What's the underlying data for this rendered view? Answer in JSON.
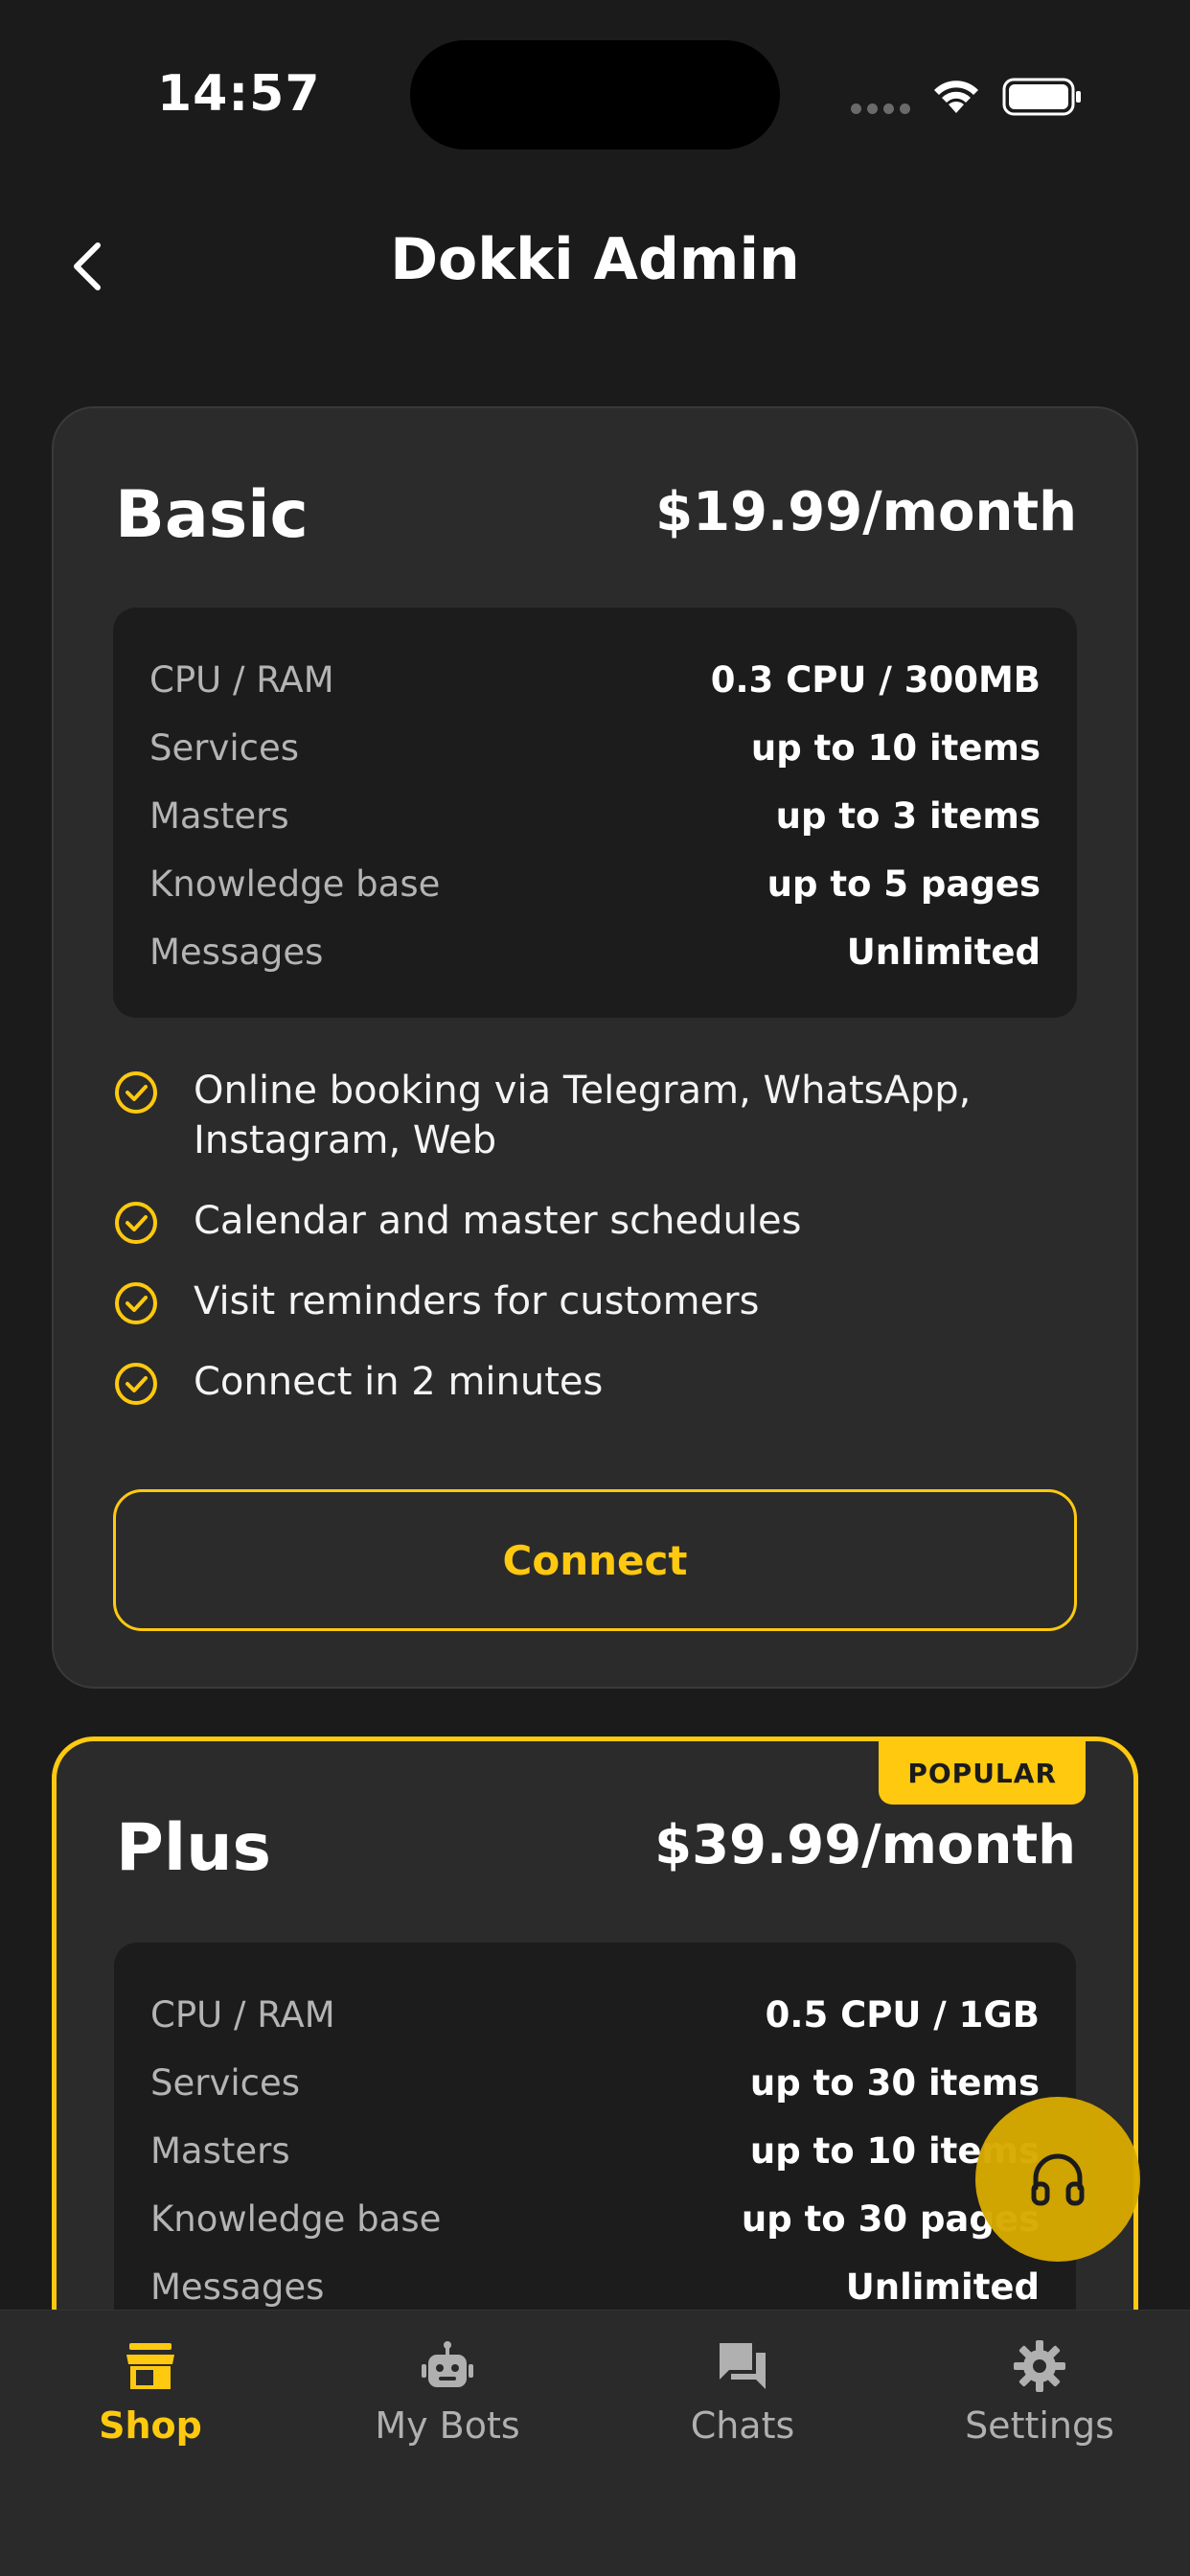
{
  "status_bar": {
    "time": "14:57"
  },
  "header": {
    "title": "Dokki Admin"
  },
  "colors": {
    "accent": "#ffc90f",
    "background": "#1b1b1b",
    "card": "#2b2b2b",
    "fab": "#d8aa00"
  },
  "plans": [
    {
      "name": "Basic",
      "price": "$19.99/month",
      "specs": [
        {
          "label": "CPU / RAM",
          "value": "0.3 CPU / 300MB"
        },
        {
          "label": "Services",
          "value": "up to 10 items"
        },
        {
          "label": "Masters",
          "value": "up to 3 items"
        },
        {
          "label": "Knowledge base",
          "value": "up to 5 pages"
        },
        {
          "label": "Messages",
          "value": "Unlimited"
        }
      ],
      "features": [
        "Online booking via Telegram, WhatsApp, Instagram, Web",
        "Calendar and master schedules",
        "Visit reminders for customers",
        "Connect in 2 minutes"
      ],
      "button_label": "Connect"
    },
    {
      "name": "Plus",
      "price": "$39.99/month",
      "badge": "POPULAR",
      "specs": [
        {
          "label": "CPU / RAM",
          "value": "0.5 CPU / 1GB"
        },
        {
          "label": "Services",
          "value": "up to 30 items"
        },
        {
          "label": "Masters",
          "value": "up to 10 items"
        },
        {
          "label": "Knowledge base",
          "value": "up to 30 pages"
        },
        {
          "label": "Messages",
          "value": "Unlimited"
        }
      ]
    }
  ],
  "fab": {
    "icon": "headset-icon"
  },
  "tab_bar": {
    "items": [
      {
        "label": "Shop",
        "icon": "store-icon",
        "active": true
      },
      {
        "label": "My Bots",
        "icon": "robot-icon",
        "active": false
      },
      {
        "label": "Chats",
        "icon": "chat-icon",
        "active": false
      },
      {
        "label": "Settings",
        "icon": "gear-icon",
        "active": false
      }
    ]
  }
}
